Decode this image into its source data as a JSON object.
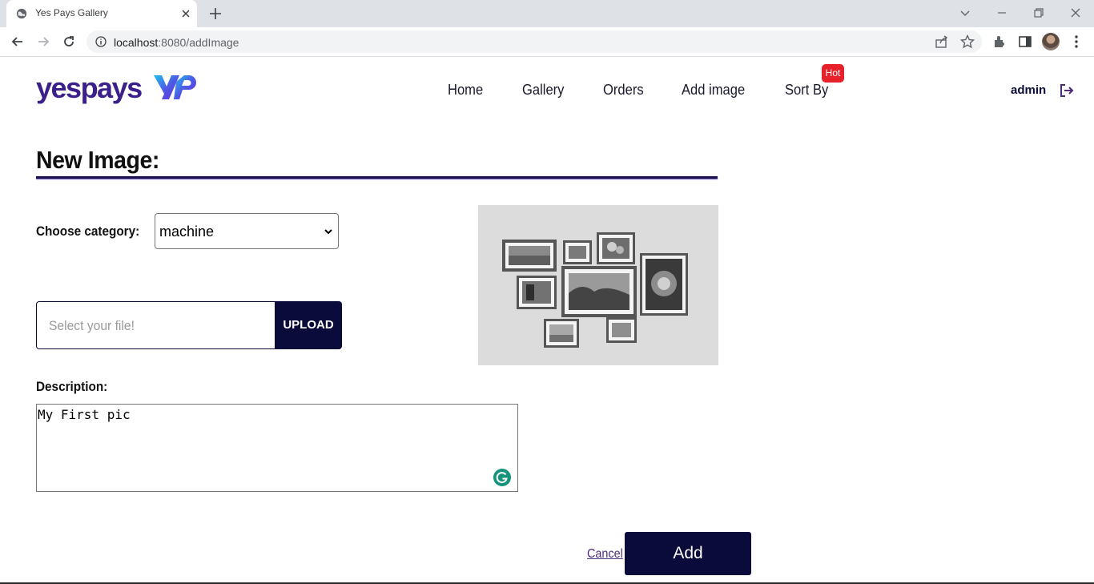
{
  "browser": {
    "tab_title": "Yes Pays Gallery",
    "url_host": "localhost",
    "url_path": ":8080/addImage"
  },
  "header": {
    "logo_text": "yespays",
    "nav": [
      "Home",
      "Gallery",
      "Orders",
      "Add image",
      "Sort By"
    ],
    "hot_badge": "Hot",
    "user": "admin"
  },
  "form": {
    "title": "New Image:",
    "category_label": "Choose category:",
    "category_value": "machine",
    "file_placeholder": "Select your file!",
    "upload_label": "UPLOAD",
    "description_label": "Description:",
    "description_value": "My First pic",
    "cancel_label": "Cancel",
    "add_label": "Add"
  },
  "colors": {
    "brand_dark": "#0b0b3b",
    "hot_red": "#e8202a",
    "logo_purple": "#3b1f8a"
  }
}
